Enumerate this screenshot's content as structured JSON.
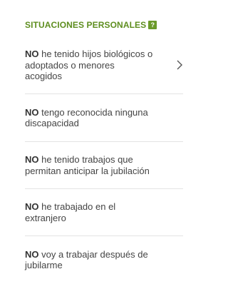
{
  "section": {
    "title": "SITUACIONES PERSONALES",
    "help_label": "?"
  },
  "items": [
    {
      "prefix": "NO",
      "text": " he tenido hijos biológicos o adoptados o menores acogidos",
      "has_chevron": true
    },
    {
      "prefix": "NO",
      "text": " tengo reconocida ninguna discapacidad",
      "has_chevron": false
    },
    {
      "prefix": "NO",
      "text": " he tenido trabajos que permitan anticipar la jubilación",
      "has_chevron": false
    },
    {
      "prefix": "NO",
      "text": " he trabajado en el extranjero",
      "has_chevron": false
    },
    {
      "prefix": "NO",
      "text": " voy a trabajar después de jubilarme",
      "has_chevron": false
    }
  ],
  "icons": {
    "help": "question-mark-icon",
    "chevron": "chevron-right-icon"
  },
  "colors": {
    "accent": "#5e8e1f",
    "help_badge": "#6b9a2a",
    "divider": "#e3e3e3",
    "text": "#444444"
  }
}
